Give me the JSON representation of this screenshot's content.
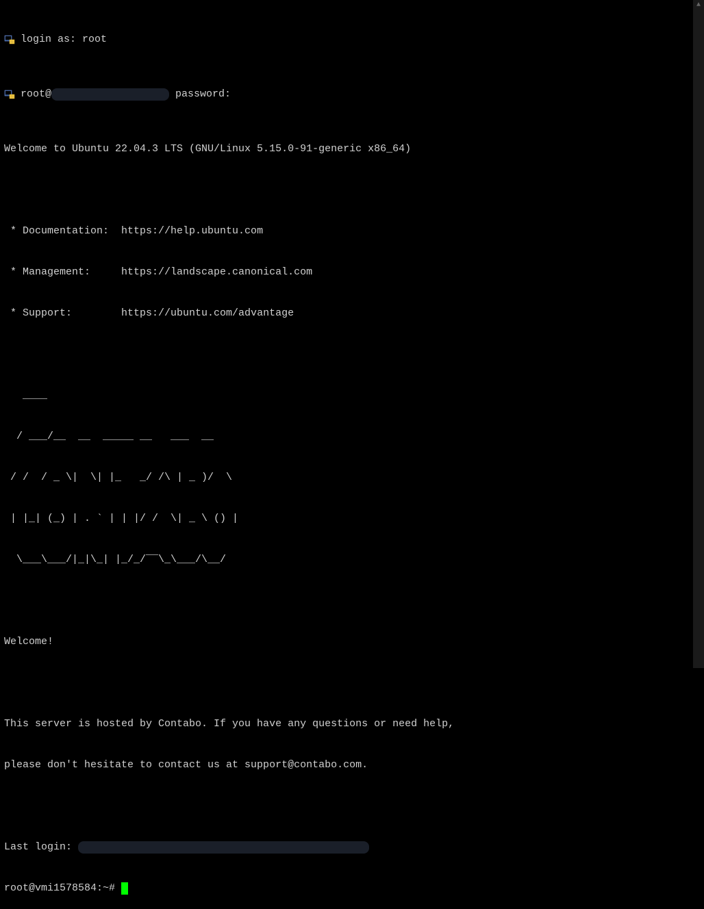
{
  "login": {
    "prompt_label": "login as: ",
    "username": "root",
    "password_prefix": "root@",
    "password_suffix": " password:"
  },
  "motd": {
    "welcome_line": "Welcome to Ubuntu 22.04.3 LTS (GNU/Linux 5.15.0-91-generic x86_64)",
    "doc_label": " * Documentation:  ",
    "doc_url": "https://help.ubuntu.com",
    "mgmt_label": " * Management:     ",
    "mgmt_url": "https://landscape.canonical.com",
    "support_label": " * Support:        ",
    "support_url": "https://ubuntu.com/advantage",
    "ascii1": "   ____",
    "ascii2": "  / ___/__  __  _____ __   ___  __",
    "ascii3": " / /  / _ \\|  \\| |_   _/ /\\ | _ )/  \\",
    "ascii4": " | |_| (_) | . ` | | |/ /  \\| _ \\ () |",
    "ascii5": "  \\___\\___/|_|\\_| |_/_/‾‾\\_\\___/\\__/",
    "welcome": "Welcome!",
    "host_msg1": "This server is hosted by Contabo. If you have any questions or need help,",
    "host_msg2": "please don't hesitate to contact us at support@contabo.com.",
    "last_login_label": "Last login: "
  },
  "prompt": {
    "text": "root@vmi1578584:~# "
  }
}
